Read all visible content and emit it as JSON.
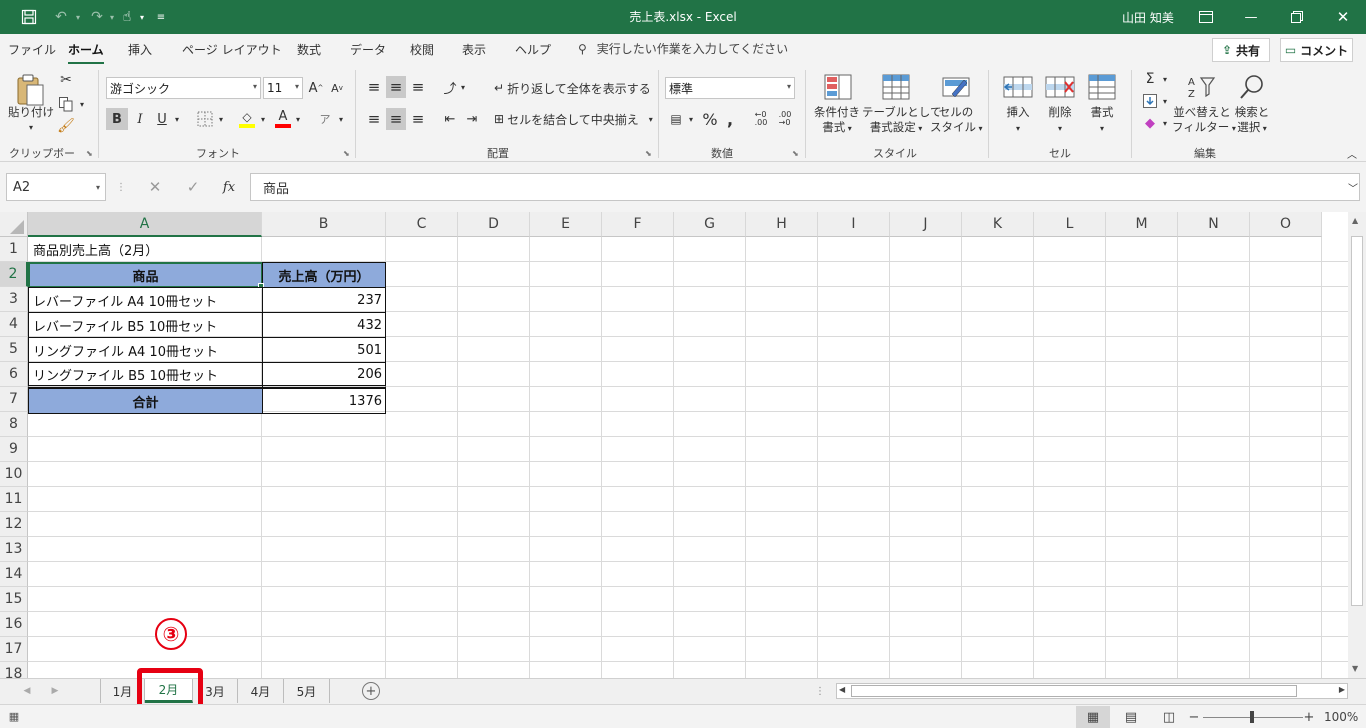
{
  "window": {
    "title": "売上表.xlsx  -  Excel",
    "user": "山田 知美"
  },
  "menu": {
    "tabs": [
      "ファイル",
      "ホーム",
      "挿入",
      "ページ レイアウト",
      "数式",
      "データ",
      "校閲",
      "表示",
      "ヘルプ"
    ],
    "active": "ホーム",
    "tell_me": "実行したい作業を入力してください",
    "share": "共有",
    "comment": "コメント"
  },
  "ribbon": {
    "clipboard": {
      "paste": "貼り付け",
      "label": "クリップボード"
    },
    "font": {
      "name": "游ゴシック",
      "size": "11",
      "label": "フォント",
      "bold": "B",
      "italic": "I",
      "underline": "U"
    },
    "alignment": {
      "wrap": "折り返して全体を表示する",
      "merge": "セルを結合して中央揃え",
      "label": "配置"
    },
    "number": {
      "format": "標準",
      "label": "数値"
    },
    "styles": {
      "conditional": [
        "条件付き",
        "書式"
      ],
      "table": [
        "テーブルとして",
        "書式設定"
      ],
      "cell": [
        "セルの",
        "スタイル"
      ],
      "label": "スタイル"
    },
    "cells": {
      "insert": "挿入",
      "delete": "削除",
      "format": "書式",
      "label": "セル"
    },
    "editing": {
      "sort": [
        "並べ替えと",
        "フィルター"
      ],
      "find": [
        "検索と",
        "選択"
      ],
      "label": "編集"
    }
  },
  "formula_bar": {
    "name_box": "A2",
    "content": "商品"
  },
  "sheet": {
    "columns": [
      "A",
      "B",
      "C",
      "D",
      "E",
      "F",
      "G",
      "H",
      "I",
      "J",
      "K",
      "L",
      "M",
      "N",
      "O"
    ],
    "rows": [
      "1",
      "2",
      "3",
      "4",
      "5",
      "6",
      "7",
      "8",
      "9",
      "10",
      "11",
      "12",
      "13",
      "14",
      "15",
      "16",
      "17",
      "18"
    ],
    "selected_col": "A",
    "selected_row": "2",
    "title": "商品別売上高（2月）",
    "header_product": "商品",
    "header_sales": "売上高（万円）",
    "items": [
      {
        "name": "レバーファイル A4 10冊セット",
        "sales": "237"
      },
      {
        "name": "レバーファイル B5 10冊セット",
        "sales": "432"
      },
      {
        "name": "リングファイル A4 10冊セット",
        "sales": "501"
      },
      {
        "name": "リングファイル B5 10冊セット",
        "sales": "206"
      }
    ],
    "total_label": "合計",
    "total_value": "1376"
  },
  "sheet_tabs": {
    "tabs": [
      "1月",
      "2月",
      "3月",
      "4月",
      "5月"
    ],
    "active": "2月",
    "step_marker": "③"
  },
  "status": {
    "zoom": "100%"
  },
  "colors": {
    "accent": "#217346",
    "header_fill": "#8eaadb",
    "highlight": "#e60012"
  }
}
